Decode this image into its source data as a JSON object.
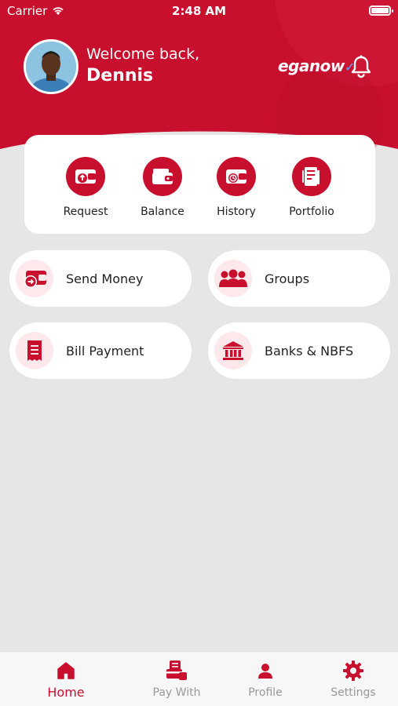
{
  "status_bar": {
    "carrier": "Carrier",
    "time": "2:48 AM"
  },
  "header": {
    "welcome": "Welcome back,",
    "user_name": "Dennis",
    "logo_text": "eganow",
    "brand_color": "#c8102e"
  },
  "quick_actions": [
    {
      "label": "Request",
      "icon": "wallet-upload-icon"
    },
    {
      "label": "Balance",
      "icon": "wallet-icon"
    },
    {
      "label": "History",
      "icon": "wallet-history-icon"
    },
    {
      "label": "Portfolio",
      "icon": "portfolio-icon"
    }
  ],
  "services": [
    {
      "label": "Send Money",
      "icon": "wallet-send-icon"
    },
    {
      "label": "Groups",
      "icon": "group-icon"
    },
    {
      "label": "Bill Payment",
      "icon": "receipt-icon"
    },
    {
      "label": "Banks & NBFS",
      "icon": "bank-icon"
    }
  ],
  "bottom_nav": [
    {
      "label": "Home",
      "icon": "home-icon",
      "active": true
    },
    {
      "label": "Pay With",
      "icon": "pay-with-icon",
      "active": false
    },
    {
      "label": "Profile",
      "icon": "profile-icon",
      "active": false
    },
    {
      "label": "Settings",
      "icon": "settings-icon",
      "active": false
    }
  ]
}
